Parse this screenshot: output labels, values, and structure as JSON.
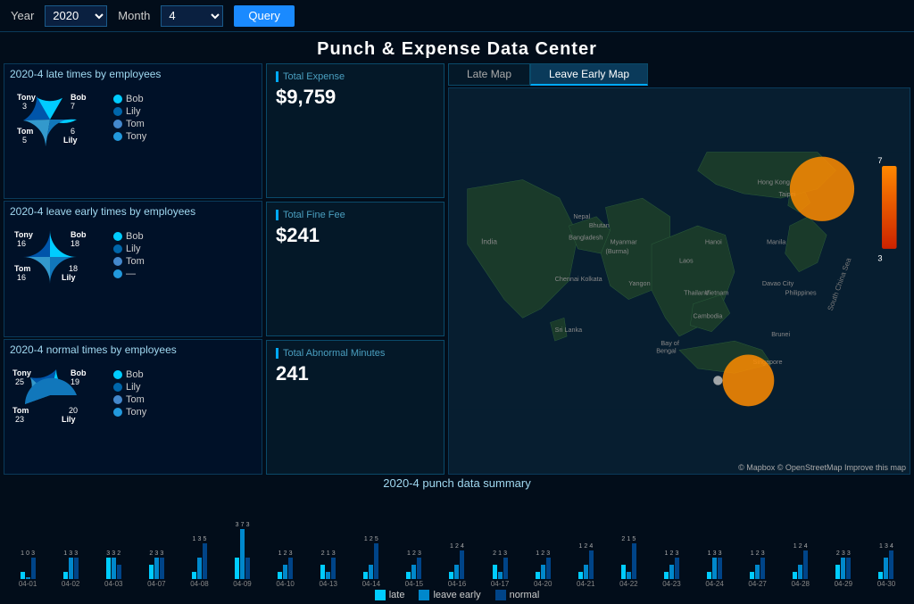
{
  "topbar": {
    "year_label": "Year",
    "year_value": "2020",
    "month_label": "Month",
    "month_value": "4",
    "query_button": "Query"
  },
  "page_title": "Punch & Expense Data Center",
  "late_section": {
    "title": "2020-4 late times by employees",
    "employees": [
      {
        "name": "Bob",
        "value": 7,
        "color": "#00ccff"
      },
      {
        "name": "Lily",
        "value": 6,
        "color": "#0066aa"
      },
      {
        "name": "Tom",
        "value": 5,
        "color": "#4488cc"
      },
      {
        "name": "Tony",
        "value": 3,
        "color": "#2299dd"
      }
    ]
  },
  "leave_early_section": {
    "title": "2020-4 leave early times by employees",
    "employees": [
      {
        "name": "Bob",
        "value": 18,
        "color": "#00ccff"
      },
      {
        "name": "Lily",
        "value": 18,
        "color": "#0066aa"
      },
      {
        "name": "Tom",
        "value": 16,
        "color": "#4488cc"
      },
      {
        "name": "Tony",
        "value": 16,
        "color": "#2299dd"
      }
    ]
  },
  "normal_section": {
    "title": "2020-4 normal times by employees",
    "employees": [
      {
        "name": "Bob",
        "value": 19,
        "color": "#00ccff"
      },
      {
        "name": "Lily",
        "value": 20,
        "color": "#0066aa"
      },
      {
        "name": "Tom",
        "value": 23,
        "color": "#4488cc"
      },
      {
        "name": "Tony",
        "value": 25,
        "color": "#2299dd"
      }
    ]
  },
  "stats": {
    "total_expense_label": "Total Expense",
    "total_expense_value": "$9,759",
    "total_fine_label": "Total Fine Fee",
    "total_fine_value": "$241",
    "total_abnormal_label": "Total Abnormal Minutes",
    "total_abnormal_value": "241"
  },
  "map_tabs": {
    "late_map": "Late Map",
    "leave_early_map": "Leave Early Map",
    "active": "Leave Early Map"
  },
  "map_credits": "© Mapbox © OpenStreetMap Improve this map",
  "scale": {
    "max": "7",
    "min": "3"
  },
  "punch_summary": {
    "title": "2020-4 punch data summary",
    "legend": {
      "late": "late",
      "leave_early": "leave early",
      "normal": "normal"
    },
    "dates": [
      {
        "date": "04-01",
        "late": 1,
        "leave_early": 0,
        "normal": 3
      },
      {
        "date": "04-02",
        "late": 1,
        "leave_early": 3,
        "normal": 3
      },
      {
        "date": "04-03",
        "late": 3,
        "leave_early": 3,
        "normal": 2
      },
      {
        "date": "04-07",
        "late": 2,
        "leave_early": 3,
        "normal": 3
      },
      {
        "date": "04-08",
        "late": 1,
        "leave_early": 3,
        "normal": 5
      },
      {
        "date": "04-09",
        "late": 3,
        "leave_early": 7,
        "normal": 3
      },
      {
        "date": "04-10",
        "late": 1,
        "leave_early": 2,
        "normal": 3
      },
      {
        "date": "04-13",
        "late": 2,
        "leave_early": 1,
        "normal": 3
      },
      {
        "date": "04-14",
        "late": 1,
        "leave_early": 2,
        "normal": 5
      },
      {
        "date": "04-15",
        "late": 1,
        "leave_early": 2,
        "normal": 3
      },
      {
        "date": "04-16",
        "late": 1,
        "leave_early": 2,
        "normal": 4
      },
      {
        "date": "04-17",
        "late": 2,
        "leave_early": 1,
        "normal": 3
      },
      {
        "date": "04-20",
        "late": 1,
        "leave_early": 2,
        "normal": 3
      },
      {
        "date": "04-21",
        "late": 1,
        "leave_early": 2,
        "normal": 4
      },
      {
        "date": "04-22",
        "late": 2,
        "leave_early": 1,
        "normal": 5
      },
      {
        "date": "04-23",
        "late": 1,
        "leave_early": 2,
        "normal": 3
      },
      {
        "date": "04-24",
        "late": 1,
        "leave_early": 3,
        "normal": 3
      },
      {
        "date": "04-27",
        "late": 1,
        "leave_early": 2,
        "normal": 3
      },
      {
        "date": "04-28",
        "late": 1,
        "leave_early": 2,
        "normal": 4
      },
      {
        "date": "04-29",
        "late": 2,
        "leave_early": 3,
        "normal": 3
      },
      {
        "date": "04-30",
        "late": 1,
        "leave_early": 3,
        "normal": 4
      }
    ]
  }
}
